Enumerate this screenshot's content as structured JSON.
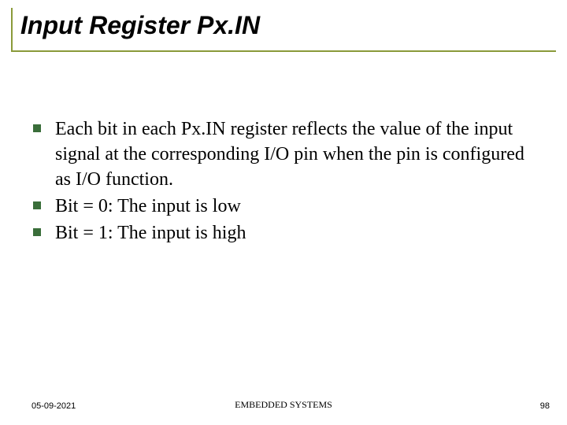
{
  "title": "Input Register Px.IN",
  "bullets": [
    "Each bit in each Px.IN register reflects the value of the input signal at the corresponding I/O pin when the pin is configured as I/O function.",
    "Bit = 0: The input is low",
    "Bit = 1: The input is high"
  ],
  "footer": {
    "date": "05-09-2021",
    "center": "EMBEDDED SYSTEMS",
    "page": "98"
  }
}
